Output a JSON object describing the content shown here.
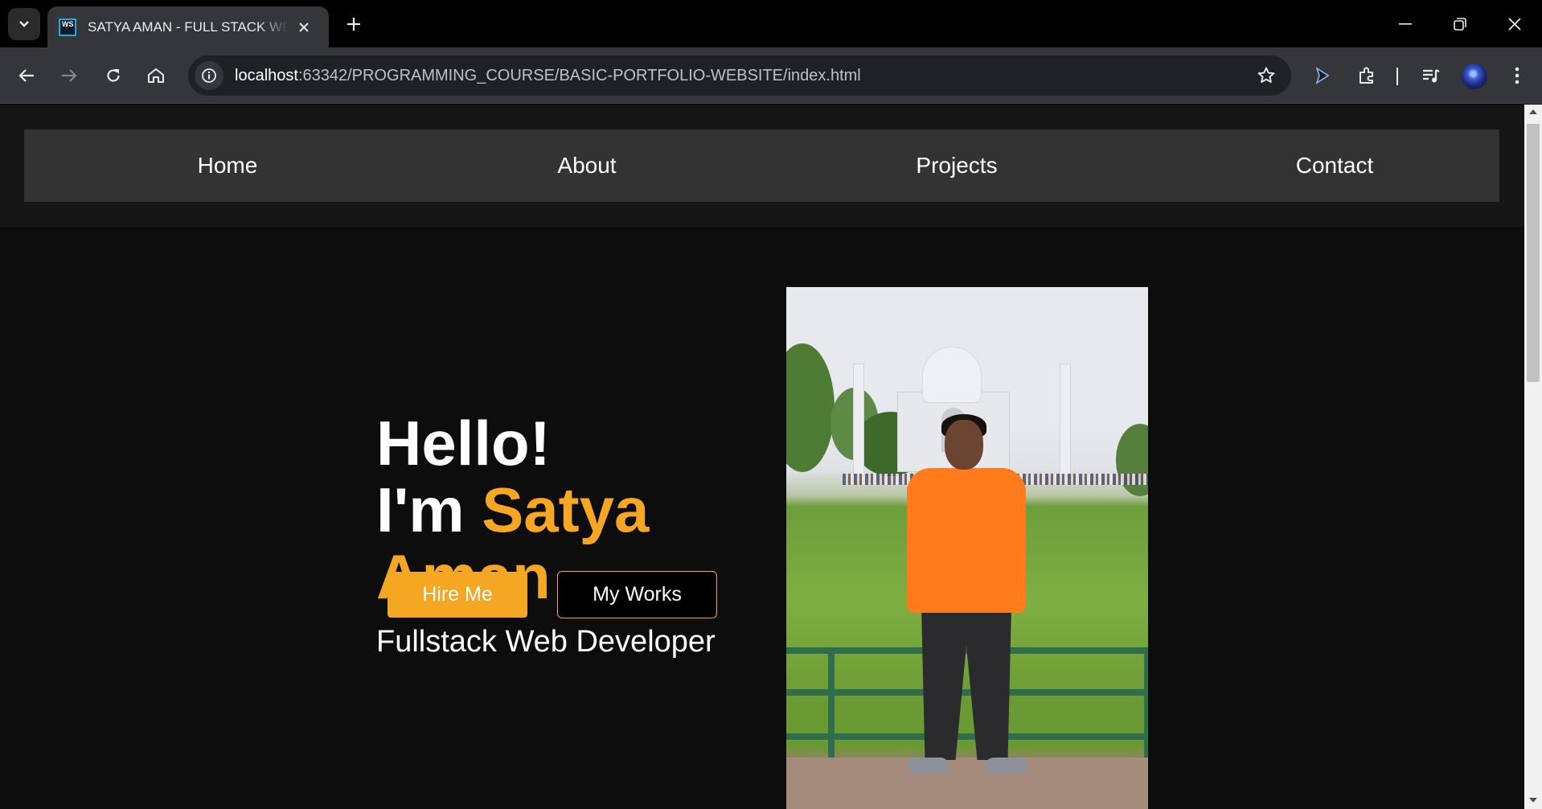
{
  "browser": {
    "tab": {
      "title": "SATYA AMAN - FULL STACK WE",
      "favicon_text": "WS"
    },
    "url": {
      "host": "localhost",
      "rest": ":63342/PROGRAMMING_COURSE/BASIC-PORTFOLIO-WEBSITE/index.html"
    },
    "icons": [
      "tab-search-icon",
      "close-icon",
      "plus-icon",
      "minimize-icon",
      "restore-icon",
      "back-icon",
      "forward-icon",
      "reload-icon",
      "home-icon",
      "info-icon",
      "star-icon",
      "cursor-extension-icon",
      "extensions-icon",
      "media-control-icon",
      "profile-avatar",
      "kebab-menu-icon"
    ]
  },
  "nav": {
    "items": [
      {
        "label": "Home"
      },
      {
        "label": "About"
      },
      {
        "label": "Projects"
      },
      {
        "label": "Contact"
      }
    ]
  },
  "hero": {
    "line1": "Hello!",
    "im": "I'm ",
    "first_name": "Satya",
    "last_name": "Aman",
    "subtitle": "Fullstack Web Developer",
    "hire_label": "Hire Me",
    "works_label": "My Works"
  },
  "colors": {
    "accent": "#f5a623",
    "background": "#0d0d0d",
    "navbar": "#333333"
  }
}
